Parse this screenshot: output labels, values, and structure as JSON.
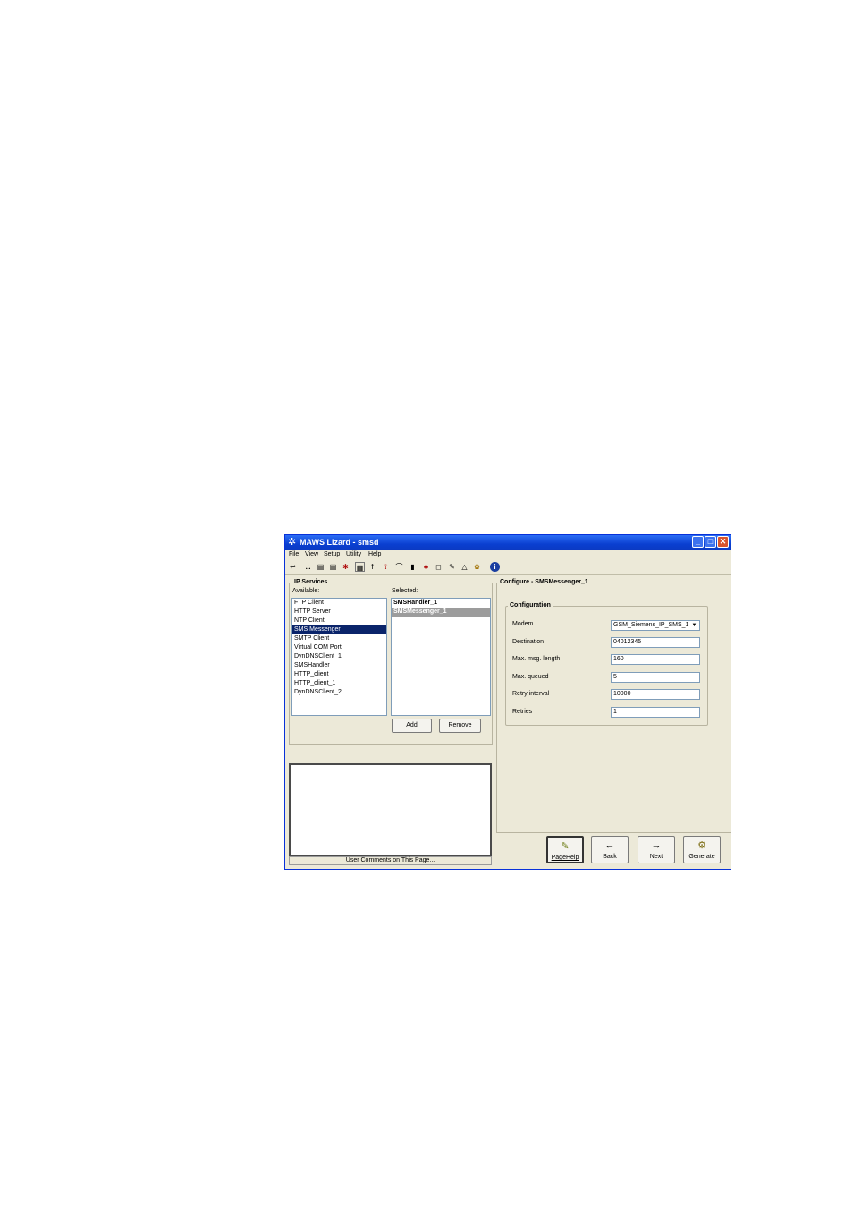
{
  "window": {
    "title": "MAWS Lizard - smsd"
  },
  "menu": [
    "File",
    "View",
    "Setup",
    "Utility",
    "Help"
  ],
  "toolbar_icons": [
    "back-arrow-icon",
    "network-icon",
    "dev-icon",
    "dev2-icon",
    "star-icon",
    "grid-icon",
    "person-icon",
    "person2-icon",
    "chart-icon",
    "bars-icon",
    "figure-icon",
    "box-icon",
    "pen-icon",
    "bell-icon",
    "gear-icon",
    "info-icon"
  ],
  "ip_services": {
    "title": "IP Services",
    "available_label": "Available:",
    "selected_label": "Selected:",
    "available": [
      "FTP Client",
      "HTTP Server",
      "NTP Client",
      "SMS Messenger",
      "SMTP Client",
      "Virtual COM Port",
      "DynDNSClient_1",
      "SMSHandler",
      "HTTP_client",
      "HTTP_client_1",
      "DynDNSClient_2"
    ],
    "available_selected_index": 3,
    "selected": [
      "SMSHandler_1",
      "SMSMessenger_1"
    ],
    "add_label": "Add",
    "remove_label": "Remove"
  },
  "comments": {
    "footer": "User Comments on This Page..."
  },
  "configure": {
    "title": "Configure - SMSMessenger_1",
    "group_title": "Configuration",
    "fields": [
      {
        "label": "Modem",
        "value": "GSM_Siemens_IP_SMS_1"
      },
      {
        "label": "Destination",
        "value": "04012345"
      },
      {
        "label": "Max. msg. length",
        "value": "160"
      },
      {
        "label": "Max. queued",
        "value": "5"
      },
      {
        "label": "Retry interval",
        "value": "10000"
      },
      {
        "label": "Retries",
        "value": "1"
      }
    ]
  },
  "nav": {
    "pagehelp": "PageHelp",
    "back": "Back",
    "next": "Next",
    "generate": "Generate"
  },
  "colors": {
    "titlebar": "#0a3fd0",
    "selection": "#0a246a",
    "face": "#ece9d8"
  }
}
